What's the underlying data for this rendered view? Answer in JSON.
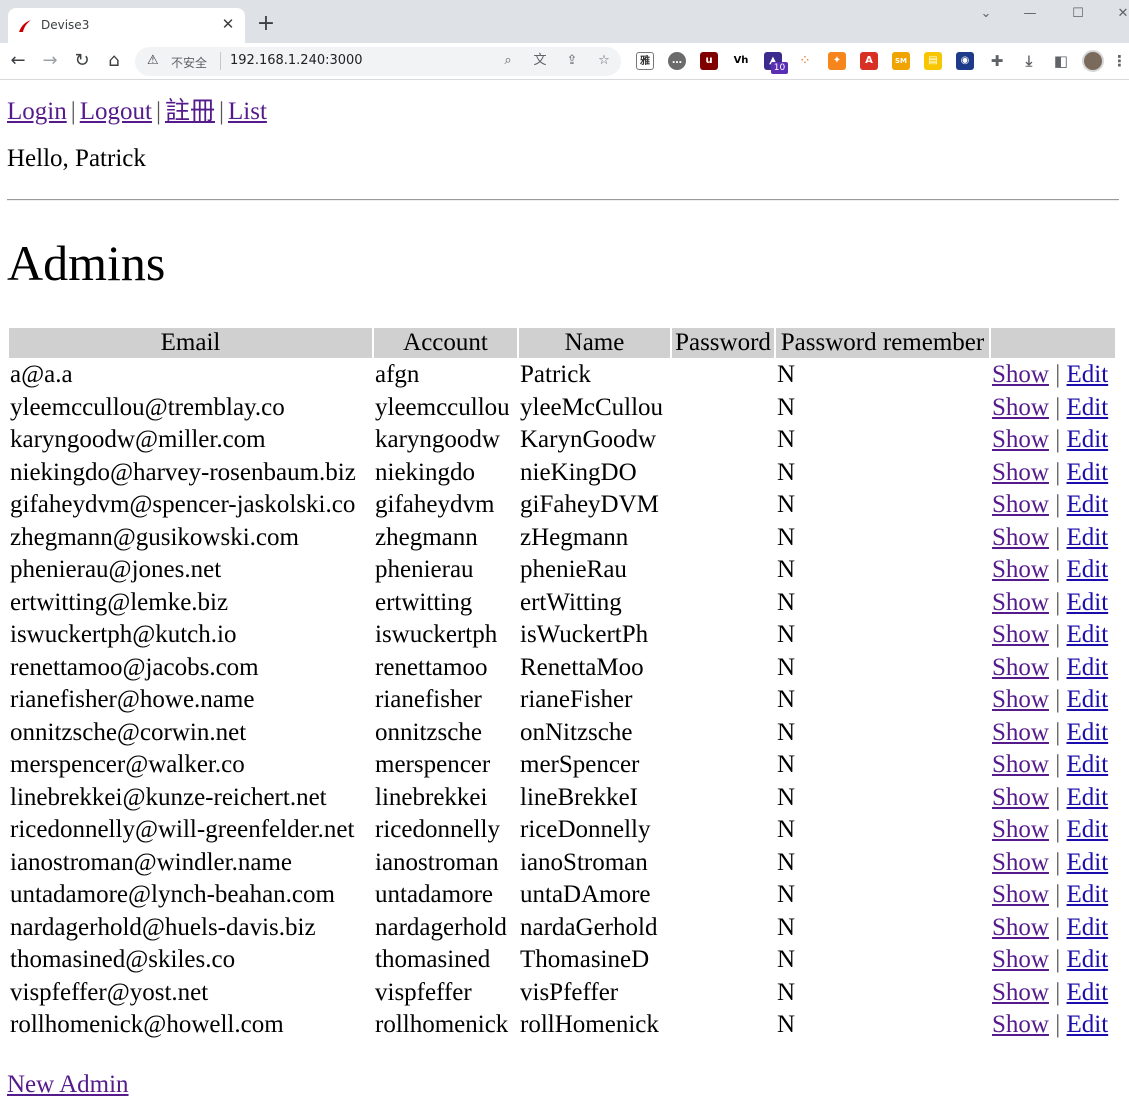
{
  "browser": {
    "tab_title": "Devise3",
    "insecure_label": "不安全",
    "url": "192.168.1.240:3000",
    "extension_badge": "10",
    "icons": [
      "back-icon",
      "forward-icon",
      "reload-icon",
      "home-icon",
      "warning-icon",
      "search-icon",
      "translate-icon",
      "share-icon",
      "star-icon",
      "extensions-icon",
      "download-icon",
      "sidepanel-icon",
      "menu-icon"
    ]
  },
  "nav": {
    "login": "Login",
    "logout": "Logout",
    "register": "註冊",
    "list": "List",
    "separator": "|"
  },
  "greeting": "Hello, Patrick",
  "title": "Admins",
  "table": {
    "headers": [
      "Email",
      "Account",
      "Name",
      "Password",
      "Password remember",
      ""
    ],
    "show_label": "Show",
    "edit_label": "Edit",
    "rows": [
      {
        "email": "a@a.a",
        "account": "afgn",
        "name": "Patrick",
        "password": "",
        "remember": "N"
      },
      {
        "email": "yleemccullou@tremblay.co",
        "account": "yleemccullou",
        "name": "yleeMcCullou",
        "password": "",
        "remember": "N"
      },
      {
        "email": "karyngoodw@miller.com",
        "account": "karyngoodw",
        "name": "KarynGoodw",
        "password": "",
        "remember": "N"
      },
      {
        "email": "niekingdo@harvey-rosenbaum.biz",
        "account": "niekingdo",
        "name": "nieKingDO",
        "password": "",
        "remember": "N"
      },
      {
        "email": "gifaheydvm@spencer-jaskolski.co",
        "account": "gifaheydvm",
        "name": "giFaheyDVM",
        "password": "",
        "remember": "N"
      },
      {
        "email": "zhegmann@gusikowski.com",
        "account": "zhegmann",
        "name": "zHegmann",
        "password": "",
        "remember": "N"
      },
      {
        "email": "phenierau@jones.net",
        "account": "phenierau",
        "name": "phenieRau",
        "password": "",
        "remember": "N"
      },
      {
        "email": "ertwitting@lemke.biz",
        "account": "ertwitting",
        "name": "ertWitting",
        "password": "",
        "remember": "N"
      },
      {
        "email": "iswuckertph@kutch.io",
        "account": "iswuckertph",
        "name": "isWuckertPh",
        "password": "",
        "remember": "N"
      },
      {
        "email": "renettamoo@jacobs.com",
        "account": "renettamoo",
        "name": "RenettaMoo",
        "password": "",
        "remember": "N"
      },
      {
        "email": "rianefisher@howe.name",
        "account": "rianefisher",
        "name": "rianeFisher",
        "password": "",
        "remember": "N"
      },
      {
        "email": "onnitzsche@corwin.net",
        "account": "onnitzsche",
        "name": "onNitzsche",
        "password": "",
        "remember": "N"
      },
      {
        "email": "merspencer@walker.co",
        "account": "merspencer",
        "name": "merSpencer",
        "password": "",
        "remember": "N"
      },
      {
        "email": "linebrekkei@kunze-reichert.net",
        "account": "linebrekkei",
        "name": "lineBrekkeI",
        "password": "",
        "remember": "N"
      },
      {
        "email": "ricedonnelly@will-greenfelder.net",
        "account": "ricedonnelly",
        "name": "riceDonnelly",
        "password": "",
        "remember": "N"
      },
      {
        "email": "ianostroman@windler.name",
        "account": "ianostroman",
        "name": "ianoStroman",
        "password": "",
        "remember": "N"
      },
      {
        "email": "untadamore@lynch-beahan.com",
        "account": "untadamore",
        "name": "untaDAmore",
        "password": "",
        "remember": "N"
      },
      {
        "email": "nardagerhold@huels-davis.biz",
        "account": "nardagerhold",
        "name": "nardaGerhold",
        "password": "",
        "remember": "N"
      },
      {
        "email": "thomasined@skiles.co",
        "account": "thomasined",
        "name": "ThomasineD",
        "password": "",
        "remember": "N"
      },
      {
        "email": "vispfeffer@yost.net",
        "account": "vispfeffer",
        "name": "visPfeffer",
        "password": "",
        "remember": "N"
      },
      {
        "email": "rollhomenick@howell.com",
        "account": "rollhomenick",
        "name": "rollHomenick",
        "password": "",
        "remember": "N"
      }
    ]
  },
  "new_admin_label": "New Admin",
  "colors": {
    "visited_link": "#551a8b",
    "link": "#1a0dab",
    "header_bg": "#d0d0d0"
  }
}
